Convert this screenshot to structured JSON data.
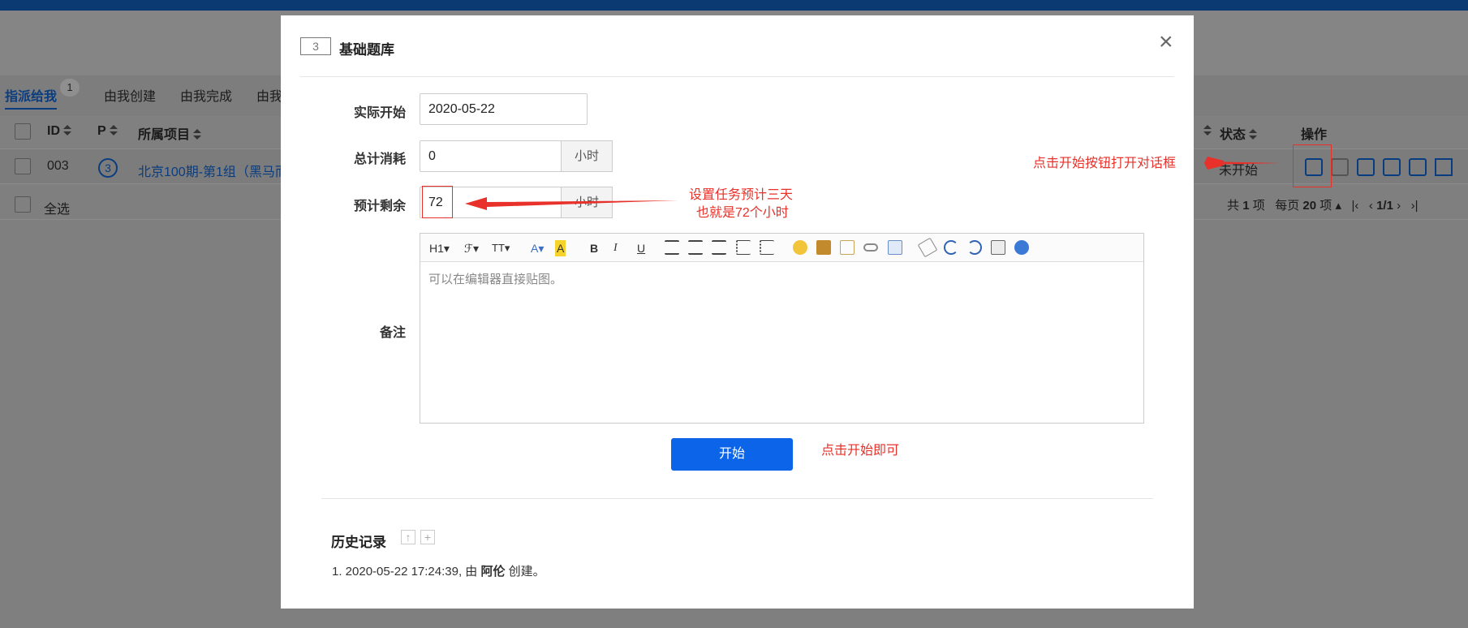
{
  "background": {
    "tabs": [
      {
        "label": "指派给我",
        "count": "1",
        "active": true
      },
      {
        "label": "由我创建"
      },
      {
        "label": "由我完成"
      },
      {
        "label": "由我"
      }
    ],
    "columns": {
      "id": "ID",
      "p": "P",
      "project": "所属项目",
      "status": "状态",
      "ops": "操作"
    },
    "row": {
      "id": "003",
      "priority": "3",
      "project": "北京100期-第1组（黑马而",
      "status": "未开始"
    },
    "select_all": "全选",
    "pagination": {
      "total_prefix": "共",
      "total": "1",
      "total_suffix": "项",
      "per_page_prefix": "每页",
      "per_page": "20",
      "per_page_suffix": "项",
      "page": "1/1"
    }
  },
  "modal": {
    "id_badge": "3",
    "title": "基础题库",
    "close": "×",
    "fields": {
      "actual_start_label": "实际开始",
      "actual_start_value": "2020-05-22",
      "total_consumed_label": "总计消耗",
      "total_consumed_value": "0",
      "remaining_label": "预计剩余",
      "remaining_value": "72",
      "unit": "小时",
      "remark_label": "备注",
      "editor_placeholder": "可以在编辑器直接贴图。"
    },
    "toolbar": {
      "h1": "H1",
      "font": "ℱ",
      "size": "TT",
      "color": "A",
      "bold": "B",
      "italic": "I",
      "underline": "U"
    },
    "start_button": "开始",
    "history": {
      "title": "历史记录",
      "entry_prefix": "1. 2020-05-22 17:24:39, 由 ",
      "entry_user": "阿伦",
      "entry_suffix": " 创建。"
    }
  },
  "annotations": {
    "open_dialog": "点击开始按钮打开对话框",
    "estimate_line1": "设置任务预计三天",
    "estimate_line2": "也就是72个小时",
    "click_start": "点击开始即可"
  },
  "colors": {
    "primary": "#0c64e8",
    "annotation": "#e8312a",
    "link": "#0a3d80"
  }
}
